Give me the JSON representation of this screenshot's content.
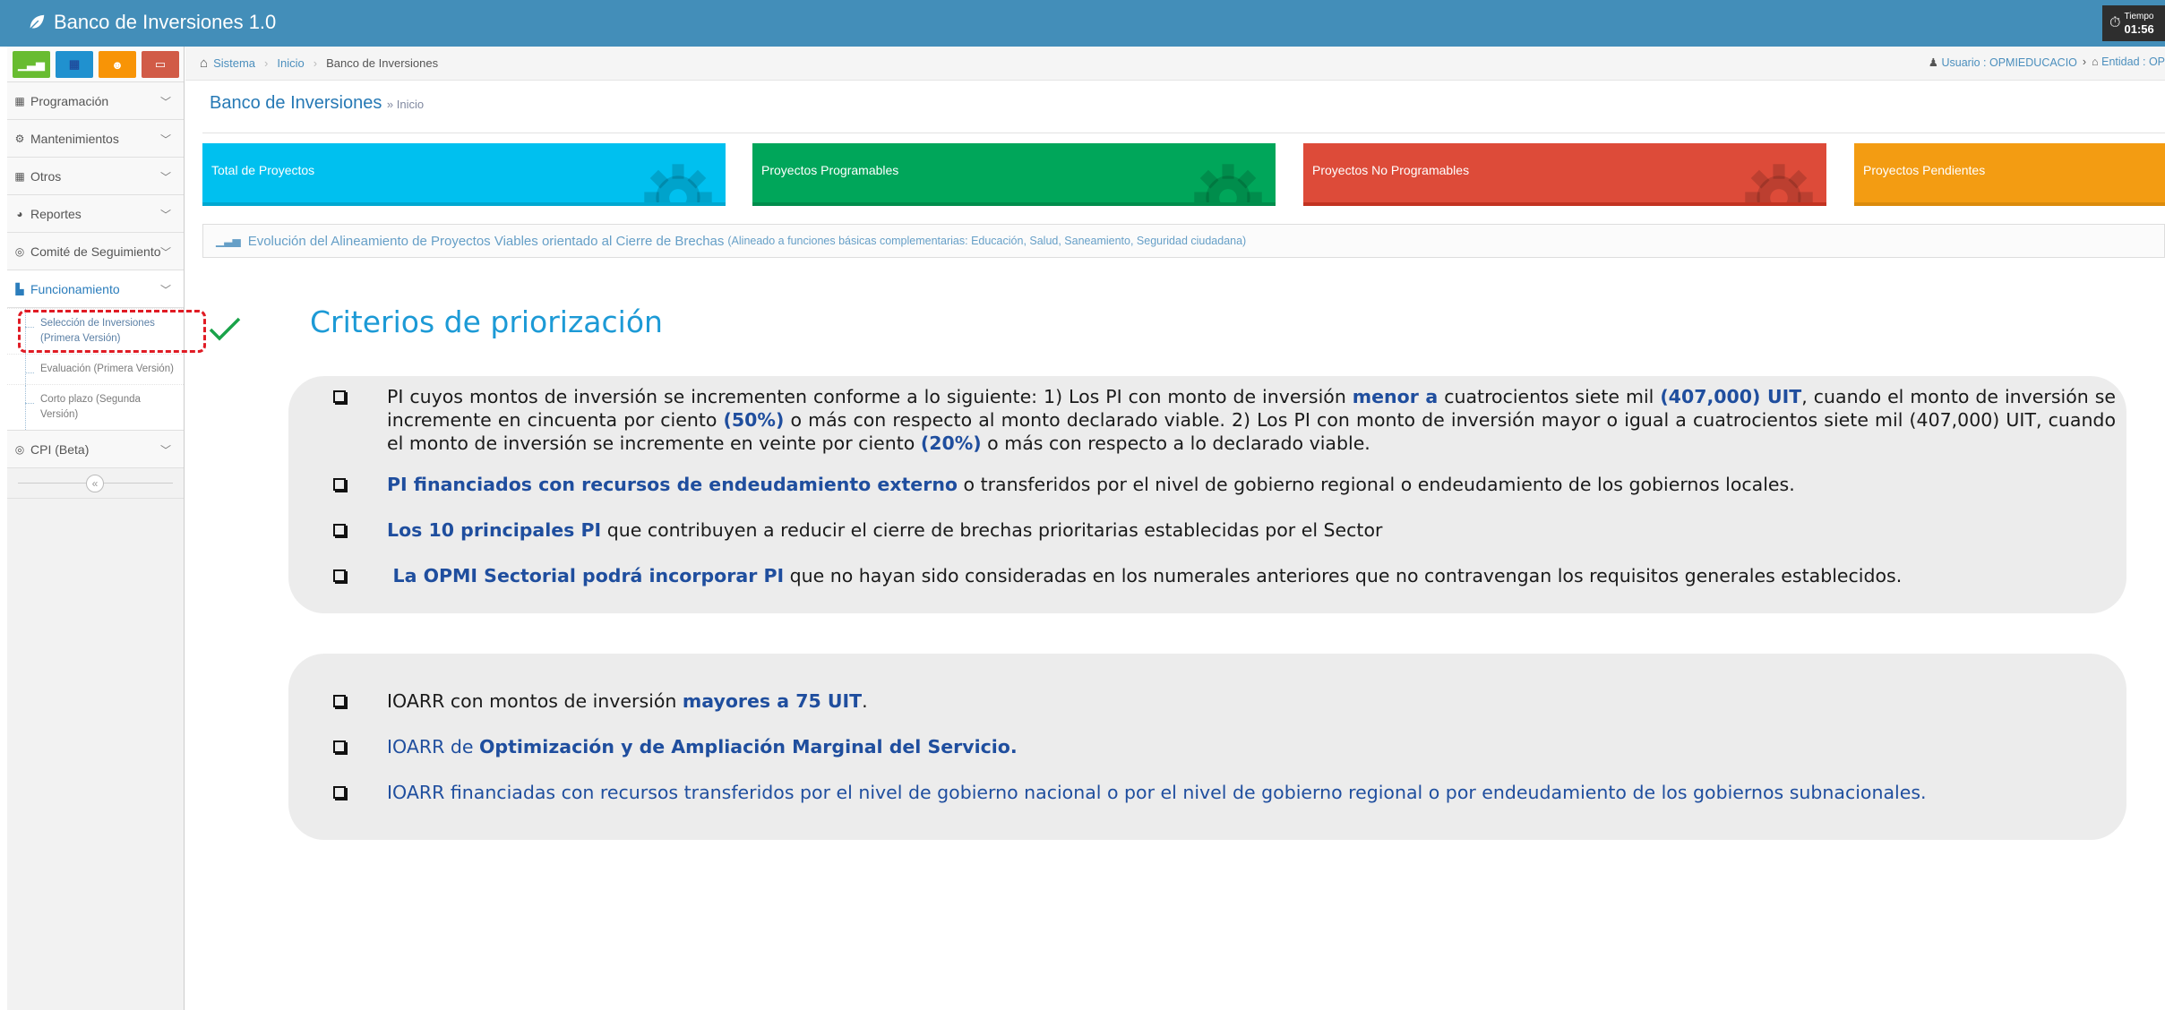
{
  "app": {
    "title": "Banco de Inversiones 1.0",
    "time_label": "Tiempo",
    "time_value": "01:56"
  },
  "shortcuts": [
    {
      "icon": "signal-icon",
      "color": "#68bc31"
    },
    {
      "icon": "calendar-icon",
      "color": "#2091cf"
    },
    {
      "icon": "users-icon",
      "color": "#f89406"
    },
    {
      "icon": "desktop-icon",
      "color": "#d15b47"
    }
  ],
  "sidebar": {
    "items": [
      {
        "label": "Programación",
        "icon": "calendar-icon"
      },
      {
        "label": "Mantenimientos",
        "icon": "cogs-icon"
      },
      {
        "label": "Otros",
        "icon": "grid-icon"
      },
      {
        "label": "Reportes",
        "icon": "pie-chart-icon"
      },
      {
        "label": "Comité de Seguimiento",
        "icon": "eye-icon"
      },
      {
        "label": "Funcionamiento",
        "icon": "bar-chart-icon"
      },
      {
        "label": "CPI (Beta)",
        "icon": "eye-icon"
      }
    ],
    "submenu": [
      "Selección de Inversiones (Primera Versión)",
      "Evaluación (Primera Versión)",
      "Corto plazo (Segunda Versión)"
    ],
    "collapse": "«"
  },
  "breadcrumb": {
    "items": [
      "Sistema",
      "Inicio",
      "Banco de Inversiones"
    ]
  },
  "user": {
    "user_label": "Usuario : OPMIEDUCACIO",
    "entity_label": "Entidad : OP"
  },
  "header": {
    "title": "Banco de Inversiones",
    "subtitle": "» Inicio"
  },
  "stats": [
    {
      "label": "Total de Proyectos",
      "color": "#00c0ef"
    },
    {
      "label": "Proyectos Programables",
      "color": "#00a65a"
    },
    {
      "label": "Proyectos No Programables",
      "color": "#dd4b39"
    },
    {
      "label": "Proyectos Pendientes",
      "color": "#f39c12"
    }
  ],
  "chart_header": {
    "title": "Evolución del Alineamiento de Proyectos Viables orientado al Cierre de Brechas",
    "note": "(Alineado a funciones básicas complementarias: Educación, Salud, Saneamiento, Seguridad ciudadana)"
  },
  "criteria": {
    "title": "Criterios de priorización",
    "b1": {
      "p1": "PI cuyos montos de inversión se incrementen conforme a lo siguiente: 1) Los PI con monto de inversión ",
      "h1": "menor a",
      "p2": " cuatrocientos siete mil ",
      "h2": "(407,000) UIT",
      "p3": ", cuando el monto de inversión se incremente en cincuenta por ciento ",
      "h3": "(50%)",
      "p4": " o más con respecto al monto declarado viable. 2) Los PI con monto de inversión mayor o igual a cuatrocientos siete mil (407,000) UIT, cuando el monto de inversión se incremente en veinte por ciento ",
      "h4": "(20%)",
      "p5": " o más con respecto a lo declarado viable."
    },
    "b2": {
      "h1": "PI financiados con recursos de endeudamiento externo",
      "p1": " o transferidos por el nivel de gobierno regional o endeudamiento de los gobiernos locales."
    },
    "b3": {
      "h1": "Los 10 principales PI",
      "p1": " que contribuyen a reducir el cierre de brechas prioritarias establecidas por el Sector"
    },
    "b4": {
      "h1": "La OPMI Sectorial podrá incorporar PI",
      "p1": " que no hayan sido consideradas en los numerales anteriores que no contravengan los requisitos generales establecidos."
    },
    "b5": {
      "p1": "IOARR con montos de inversión ",
      "h1": "mayores a 75 UIT",
      "p2": "."
    },
    "b6": {
      "p1": "IOARR de ",
      "h1": "Optimización y de Ampliación Marginal del Servicio."
    },
    "b7": {
      "p1": "IOARR financiadas con recursos transferidos por el nivel de gobierno nacional o por el nivel de gobierno regional o por endeudamiento de los gobiernos subnacionales."
    }
  }
}
